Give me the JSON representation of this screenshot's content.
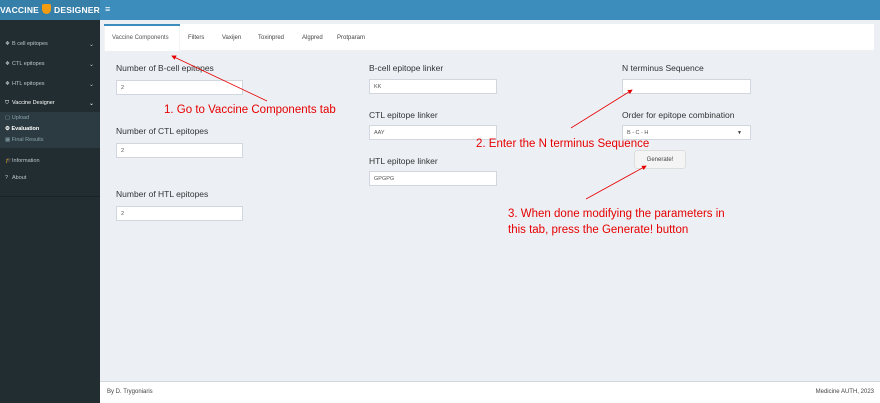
{
  "header": {
    "logo_left": "VACCINE",
    "logo_right": "DESIGNER",
    "menu_icon": "hamburger-icon"
  },
  "sidebar": {
    "items": [
      {
        "label": "B cell epitopes",
        "icon": "tag-icon"
      },
      {
        "label": "CTL epitopes",
        "icon": "tag-icon"
      },
      {
        "label": "HTL epitopes",
        "icon": "tag-icon"
      },
      {
        "label": "Vaccine Designer",
        "icon": "shield-icon"
      }
    ],
    "subitems": [
      {
        "label": "Upload",
        "icon": "file-icon"
      },
      {
        "label": "Evaluation",
        "icon": "cogs-icon"
      },
      {
        "label": "Final Results",
        "icon": "table-icon"
      }
    ],
    "information": "Information",
    "about": "About"
  },
  "tabs": [
    "Vaccine Components",
    "Filters",
    "Vaxijen",
    "Toxinpred",
    "Algpred",
    "Protparam"
  ],
  "form": {
    "bcell_count_label": "Number of B-cell epitopes",
    "bcell_count_value": "2",
    "ctl_count_label": "Number of CTL epitopes",
    "ctl_count_value": "2",
    "htl_count_label": "Number of HTL epitopes",
    "htl_count_value": "2",
    "bcell_linker_label": "B-cell epitope linker",
    "bcell_linker_value": "KK",
    "ctl_linker_label": "CTL epitope linker",
    "ctl_linker_value": "AAY",
    "htl_linker_label": "HTL epitope linker",
    "htl_linker_value": "GPGPG",
    "nterm_label": "N terminus Sequence",
    "nterm_value": "",
    "order_label": "Order for epitope combination",
    "order_value": "B - C - H",
    "generate_label": "Generate!"
  },
  "annotations": {
    "step1": "1. Go to Vaccine Components tab",
    "step2": "2. Enter the N terminus Sequence",
    "step3_line1": "3. When done modifying the parameters in",
    "step3_line2": "this tab, press the Generate! button"
  },
  "footer": {
    "left": "By D. Trygoniaris",
    "right": "Medicine AUTH, 2023"
  },
  "colors": {
    "header": "#3c8dbc",
    "sidebar": "#222d32",
    "annotation": "#e60000"
  }
}
